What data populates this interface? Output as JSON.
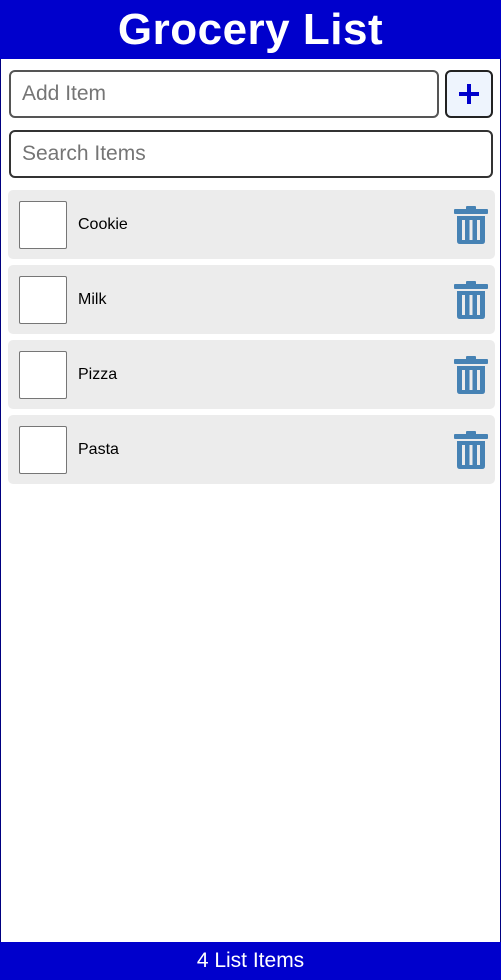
{
  "header": {
    "title": "Grocery List"
  },
  "add_item": {
    "placeholder": "Add Item",
    "value": ""
  },
  "search": {
    "placeholder": "Search Items",
    "value": ""
  },
  "items": [
    {
      "label": "Cookie",
      "checked": false
    },
    {
      "label": "Milk",
      "checked": false
    },
    {
      "label": "Pizza",
      "checked": false
    },
    {
      "label": "Pasta",
      "checked": false
    }
  ],
  "footer": {
    "count_text": "4 List Items"
  },
  "colors": {
    "brand": "#0000cc",
    "trash_icon": "#4682b4",
    "item_bg": "#ececec",
    "add_button_bg": "#eef4fd"
  },
  "icons": {
    "add": "plus-icon",
    "delete": "trash-icon"
  }
}
